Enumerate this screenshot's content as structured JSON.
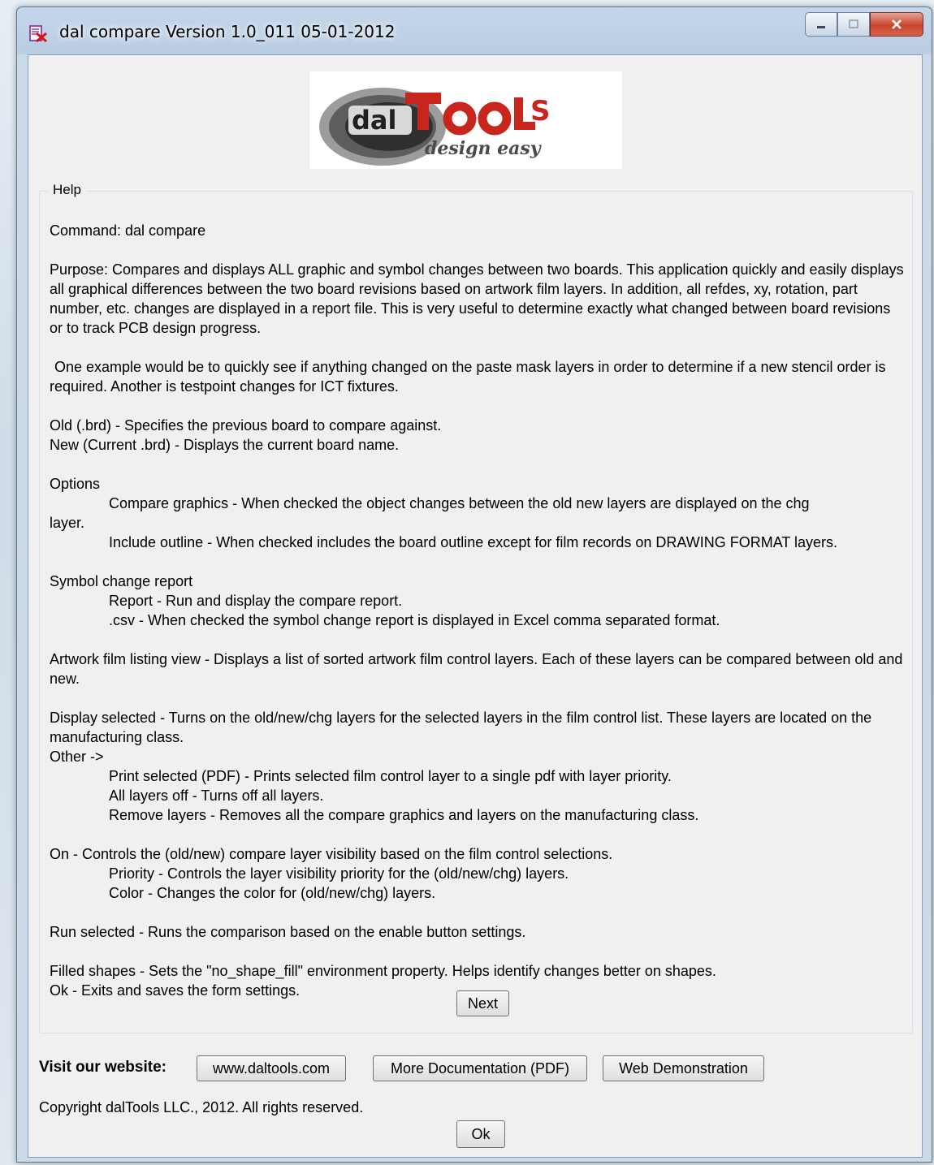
{
  "window": {
    "title": "dal compare Version 1.0_011 05-01-2012"
  },
  "logo": {
    "brand": "dalTooLS",
    "tagline": "design easy"
  },
  "help": {
    "group_label": "Help",
    "command": "Command: dal compare",
    "purpose": "Purpose: Compares and displays ALL graphic and symbol changes between two boards.  This application quickly and easily displays all graphical differences between the two board revisions based on artwork film layers. In addition, all refdes, xy, rotation, part number, etc. changes are displayed in a report file.  This is very useful to determine exactly what changed between board revisions or to track PCB design progress.",
    "example": "One example would be to quickly see if anything changed on the paste mask layers in order to determine if a new stencil order is required.  Another is testpoint changes for ICT fixtures.",
    "old_line": "Old (.brd) - Specifies the previous board to compare against.",
    "new_line": "New (Current .brd) - Displays the current board name.",
    "options_heading": "Options",
    "options_compare_graphics": "Compare graphics - When checked the object changes between the old new layers are displayed on the chg",
    "options_compare_graphics_wrap": "layer.",
    "options_include_outline": "Include outline - When checked includes the board outline except for film records on DRAWING FORMAT layers.",
    "symbol_heading": "Symbol change report",
    "symbol_report": "Report - Run and display the compare report.",
    "symbol_csv": ".csv - When checked the symbol change report is displayed in Excel comma separated format.",
    "artwork": "Artwork film listing view - Displays a list of sorted artwork film control layers.  Each of these layers can be compared between old and new.",
    "display_selected": "Display selected - Turns on the old/new/chg layers for the selected layers in the film control list.  These layers are located on the manufacturing class.",
    "other_heading": "Other ->",
    "other_print": "Print selected (PDF) - Prints selected film control layer to a single pdf with layer priority.",
    "other_all_off": "All layers off - Turns off all layers.",
    "other_remove": "Remove layers - Removes all the compare graphics and layers on the manufacturing class.",
    "on_line": "On - Controls the (old/new) compare layer visibility based on the film control selections.",
    "on_priority": "Priority - Controls the layer visibility priority for the (old/new/chg) layers.",
    "on_color": "Color - Changes the color for (old/new/chg) layers.",
    "run_selected": "Run selected - Runs the comparison based on the enable button settings.",
    "filled_shapes": "Filled shapes - Sets the \"no_shape_fill\" environment property.  Helps identify changes better on shapes.",
    "ok_line": "Ok - Exits and saves the form settings.",
    "next_label": "Next"
  },
  "footer": {
    "visit_label": "Visit our website:",
    "website_button": "www.daltools.com",
    "docs_button": "More Documentation (PDF)",
    "demo_button": "Web Demonstration",
    "copyright": "Copyright dalTools LLC., 2012. All rights reserved.",
    "ok_label": "Ok"
  },
  "colors": {
    "close_button": "#c9442c",
    "logo_red": "#c8261d",
    "logo_dark": "#3b3b3b"
  }
}
